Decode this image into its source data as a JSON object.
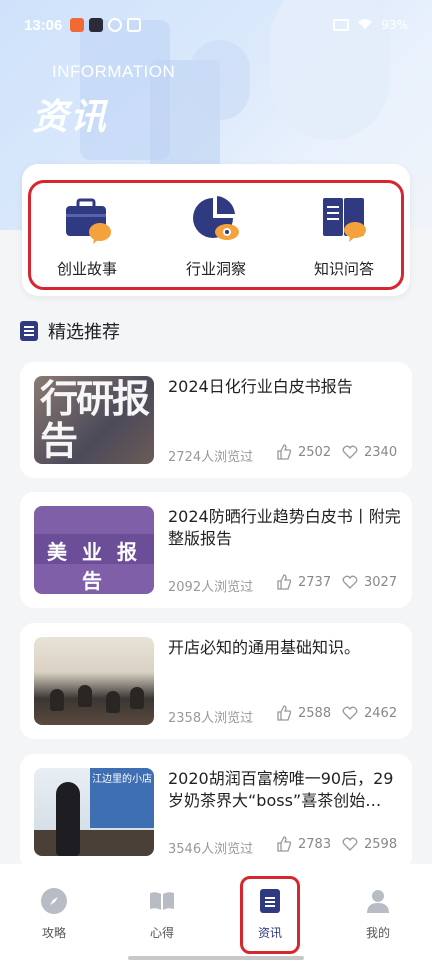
{
  "status": {
    "time": "13:06",
    "battery": "93%"
  },
  "header": {
    "subtitle": "INFORMATION",
    "title": "资讯"
  },
  "categories": [
    {
      "label": "创业故事",
      "icon": "briefcase-icon"
    },
    {
      "label": "行业洞察",
      "icon": "pie-chart-icon"
    },
    {
      "label": "知识问答",
      "icon": "book-chat-icon"
    }
  ],
  "section": {
    "title": "精选推荐"
  },
  "articles": [
    {
      "title": "2024日化行业白皮书报告",
      "views": "2724人浏览过",
      "likes": "2502",
      "favs": "2340",
      "thumb_text": "行研报告"
    },
    {
      "title": "2024防晒行业趋势白皮书丨附完整版报告",
      "views": "2092人浏览过",
      "likes": "2737",
      "favs": "3027",
      "thumb_text": "美 业 报 告"
    },
    {
      "title": "开店必知的通用基础知识。",
      "views": "2358人浏览过",
      "likes": "2588",
      "favs": "2462"
    },
    {
      "title": "2020胡润百富榜唯一90后，29岁奶茶界大“boss”喜茶创始…",
      "views": "3546人浏览过",
      "likes": "2783",
      "favs": "2598",
      "thumb_text": "江边里的小店"
    }
  ],
  "nav": [
    {
      "label": "攻略",
      "icon": "compass-icon"
    },
    {
      "label": "心得",
      "icon": "open-book-icon"
    },
    {
      "label": "资讯",
      "icon": "document-icon"
    },
    {
      "label": "我的",
      "icon": "person-icon"
    }
  ],
  "colors": {
    "accent": "#2f3a80",
    "highlight": "#d8262e",
    "orange": "#f4a23b"
  }
}
